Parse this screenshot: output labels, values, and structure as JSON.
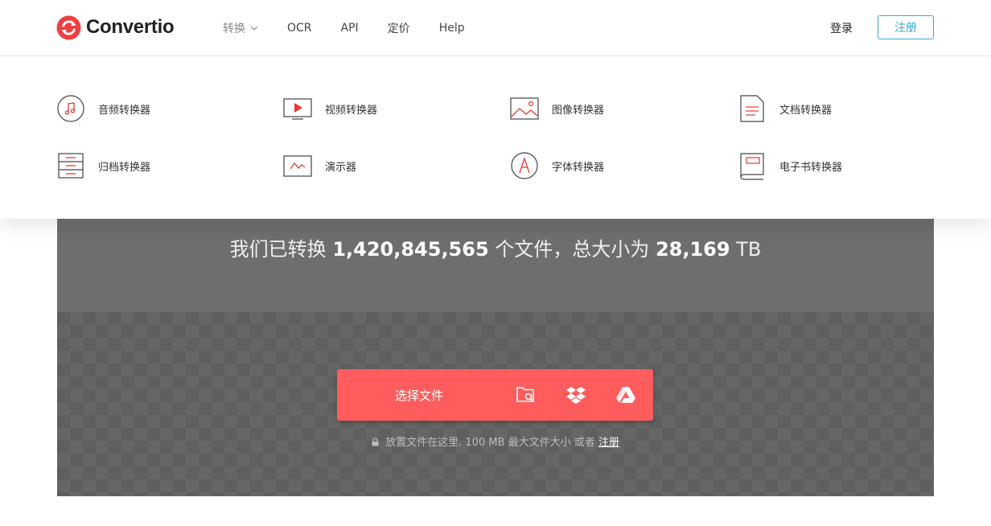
{
  "brand": {
    "name": "Convertio",
    "accent": "#ff5d5d",
    "link_color": "#3aa8d8"
  },
  "nav": {
    "items": [
      {
        "label": "转换",
        "has_dropdown": true
      },
      {
        "label": "OCR"
      },
      {
        "label": "API"
      },
      {
        "label": "定价"
      },
      {
        "label": "Help"
      }
    ],
    "login": "登录",
    "register": "注册"
  },
  "dropdown": {
    "items": [
      {
        "label": "音频转换器",
        "icon": "music-note-icon"
      },
      {
        "label": "视频转换器",
        "icon": "video-play-icon"
      },
      {
        "label": "图像转换器",
        "icon": "image-icon"
      },
      {
        "label": "文档转换器",
        "icon": "document-icon"
      },
      {
        "label": "归档转换器",
        "icon": "archive-icon"
      },
      {
        "label": "演示器",
        "icon": "presentation-icon"
      },
      {
        "label": "字体转换器",
        "icon": "font-icon"
      },
      {
        "label": "电子书转换器",
        "icon": "ebook-icon"
      }
    ]
  },
  "hero": {
    "stats_prefix": "我们已转换",
    "files_count": "1,420,845,565",
    "stats_middle": "个文件，总大小为",
    "total_size": "28,169",
    "size_unit": "TB",
    "choose_label": "选择文件",
    "source_icons": [
      "folder-search-icon",
      "dropbox-icon",
      "google-drive-icon"
    ],
    "note_text": "放置文件在这里. 100 MB 最大文件大小 或者",
    "note_link": "注册"
  }
}
